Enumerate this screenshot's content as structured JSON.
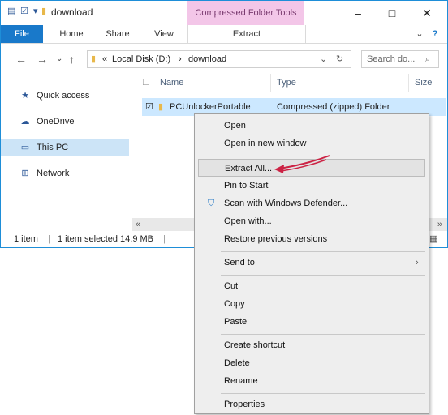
{
  "window": {
    "title": "download",
    "contextual_tab": "Compressed Folder Tools",
    "ribbon_tabs": [
      "File",
      "Home",
      "Share",
      "View"
    ],
    "extract_tab": "Extract"
  },
  "address": {
    "prefix": "«",
    "path1": "Local Disk (D:)",
    "sep": "›",
    "path2": "download",
    "search_placeholder": "Search do..."
  },
  "nav": {
    "items": [
      {
        "label": "Quick access",
        "icon": "star-icon"
      },
      {
        "label": "OneDrive",
        "icon": "cloud-icon"
      },
      {
        "label": "This PC",
        "icon": "computer-icon"
      },
      {
        "label": "Network",
        "icon": "network-icon"
      }
    ]
  },
  "columns": {
    "name": "Name",
    "type": "Type",
    "size": "Size"
  },
  "file": {
    "name": "PCUnlockerPortable",
    "type": "Compressed (zipped) Folder"
  },
  "status": {
    "count": "1 item",
    "selected": "1 item selected 14.9 MB"
  },
  "menu": {
    "items": [
      "Open",
      "Open in new window",
      "Extract All...",
      "Pin to Start",
      "Scan with Windows Defender...",
      "Open with...",
      "Restore previous versions",
      "Send to",
      "Cut",
      "Copy",
      "Paste",
      "Create shortcut",
      "Delete",
      "Rename",
      "Properties"
    ]
  },
  "colors": {
    "accent": "#1979ca",
    "context_tab": "#f3c6e8",
    "selection": "#cce8ff",
    "annotation": "#cc2244"
  }
}
